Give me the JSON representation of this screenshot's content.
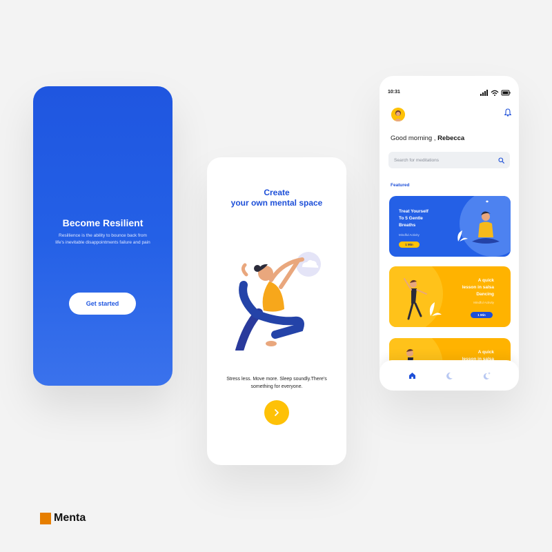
{
  "splash": {
    "title": "Become Resilient",
    "subtitle": "Resillience is the ability to bounce back from life's inevitable disappointments failure and pain",
    "cta_label": "Get started"
  },
  "onboarding": {
    "title_line1": "Create",
    "title_line2": "your own mental space",
    "description": "Stress less. Move more. Sleep soundly.There's something for everyone.",
    "next_icon": "chevron-right-icon"
  },
  "home": {
    "status_time": "10:31",
    "greeting_prefix": "Good morning ,",
    "user_name": "Rebecca",
    "search_placeholder": "Search for meditations",
    "featured_label": "Featured",
    "cards": [
      {
        "title_line1": "Treat Yourself",
        "title_line2": "To 5 Gentle",
        "title_line3": "Breaths",
        "subtitle": "Mindful Activity",
        "duration": "1 Min"
      },
      {
        "title_line1": "A quick",
        "title_line2": "lesson in salsa",
        "title_line3": "Dancing",
        "subtitle": "Mindful Activity",
        "duration": "1 Min"
      },
      {
        "title_line1": "A quick",
        "title_line2": "lesson in salsa"
      }
    ],
    "tabs": [
      "home-icon",
      "moon-icon",
      "sparkle-moon-icon"
    ]
  },
  "brand": {
    "name": "Menta"
  },
  "colors": {
    "primary_blue": "#1f56e0",
    "accent_yellow": "#fec107",
    "card_orange": "#ffb300",
    "brand_orange": "#e67e00"
  }
}
